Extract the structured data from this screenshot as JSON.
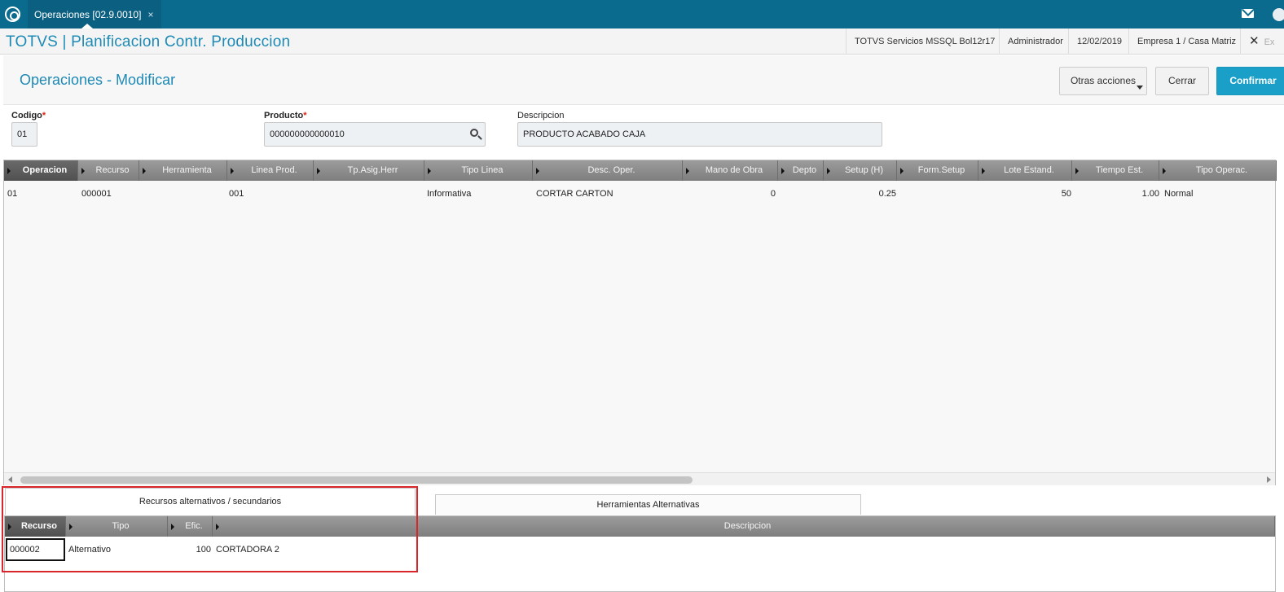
{
  "topbar": {
    "tab_label": "Operaciones [02.9.0010]",
    "tab_close": "×"
  },
  "header": {
    "app_title": "TOTVS | Planificacion Contr. Produccion",
    "environment": "TOTVS Servicios MSSQL Bol12r17",
    "user": "Administrador",
    "date": "12/02/2019",
    "company": "Empresa 1 / Casa Matriz",
    "exit_label": "Ex"
  },
  "form": {
    "title": "Operaciones - Modificar",
    "buttons": {
      "otras_acciones": "Otras acciones",
      "cerrar": "Cerrar",
      "confirmar": "Confirmar"
    },
    "fields": {
      "codigo_label": "Codigo",
      "codigo_value": "01",
      "producto_label": "Producto",
      "producto_value": "000000000000010",
      "descripcion_label": "Descripcion",
      "descripcion_value": "PRODUCTO ACABADO CAJA",
      "required_mark": "*"
    }
  },
  "operations_grid": {
    "columns": [
      "Operacion",
      "Recurso",
      "Herramienta",
      "Linea Prod.",
      "Tp.Asig.Herr",
      "Tipo Linea",
      "Desc. Oper.",
      "Mano de Obra",
      "Depto",
      "Setup (H)",
      "Form.Setup",
      "Lote Estand.",
      "Tiempo Est.",
      "Tipo Operac."
    ],
    "rows": [
      {
        "operacion": "01",
        "recurso": "000001",
        "herramienta": "",
        "linea_prod": "001",
        "tp_asig_herr": "",
        "tipo_linea": "Informativa",
        "desc_oper": "CORTAR CARTON",
        "mano_de_obra": "0",
        "depto": "",
        "setup_h": "0.25",
        "form_setup": "",
        "lote_estand": "50",
        "tiempo_est": "1.00",
        "tipo_operac": "Normal"
      }
    ]
  },
  "bottom_tabs": {
    "tab1": "Recursos alternativos / secundarios",
    "tab2": "Herramientas Alternativas"
  },
  "alt_grid": {
    "columns": [
      "Recurso",
      "Tipo",
      "Efic.",
      "Descripcion"
    ],
    "rows": [
      {
        "recurso": "000002",
        "tipo": "Alternativo",
        "efic": "100",
        "descripcion": "CORTADORA 2"
      }
    ]
  },
  "colors": {
    "topbar": "#0a6b8e",
    "accent": "#1e8ab5",
    "confirm": "#1aa0c8",
    "highlight_box": "#d9262c"
  }
}
